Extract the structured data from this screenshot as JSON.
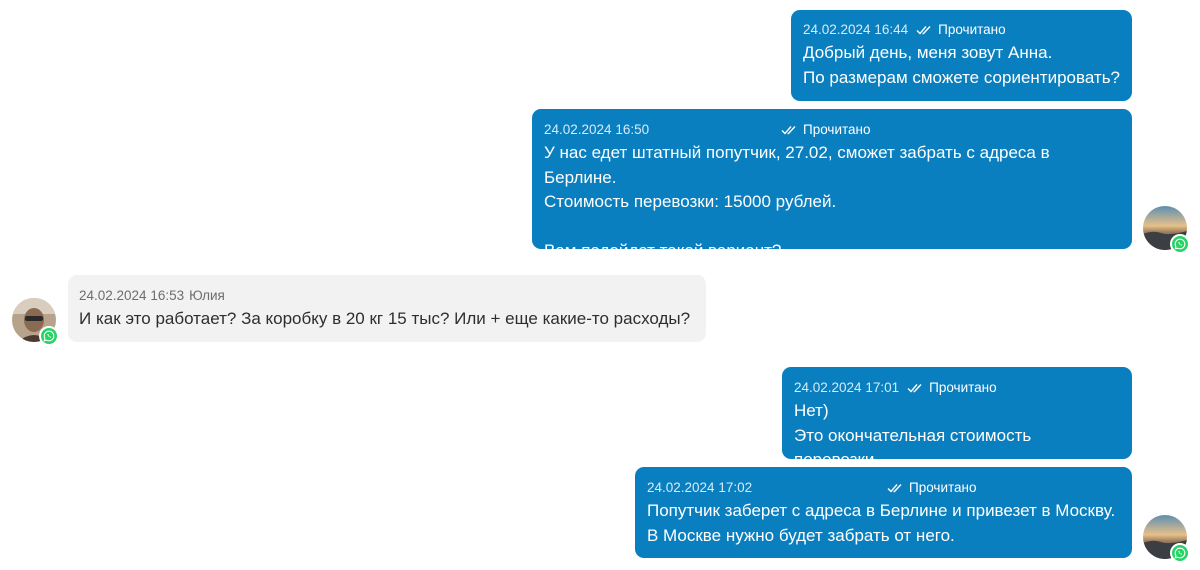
{
  "messages": [
    {
      "direction": "outgoing",
      "timestamp": "24.02.2024 16:44",
      "status": "Прочитано",
      "text": "Добрый день, меня зовут Анна.\nПо размерам сможете сориентировать?"
    },
    {
      "direction": "outgoing",
      "timestamp": "24.02.2024 16:50",
      "status": "Прочитано",
      "text": "У нас едет штатный попутчик, 27.02, сможет забрать с адреса в Берлине.\nСтоимость перевозки: 15000 рублей.\n\nВам подойдет такой вариант?"
    },
    {
      "direction": "incoming",
      "timestamp": "24.02.2024 16:53",
      "sender": "Юлия",
      "text": "И как это работает? За коробку в 20 кг 15 тыс? Или + еще какие-то расходы?"
    },
    {
      "direction": "outgoing",
      "timestamp": "24.02.2024 17:01",
      "status": "Прочитано",
      "text": "Нет)\nЭто окончательная стоимость перевозки."
    },
    {
      "direction": "outgoing",
      "timestamp": "24.02.2024 17:02",
      "status": "Прочитано",
      "text": "Попутчик заберет с адреса в Берлине и привезет в Москву.\nВ Москве нужно будет забрать от него."
    }
  ],
  "icons": {
    "read_status": "double-check-icon",
    "channel": "whatsapp-icon"
  },
  "colors": {
    "outgoing_bubble": "#0a7fbf",
    "incoming_bubble": "#f2f2f2",
    "whatsapp_badge": "#25d366"
  }
}
